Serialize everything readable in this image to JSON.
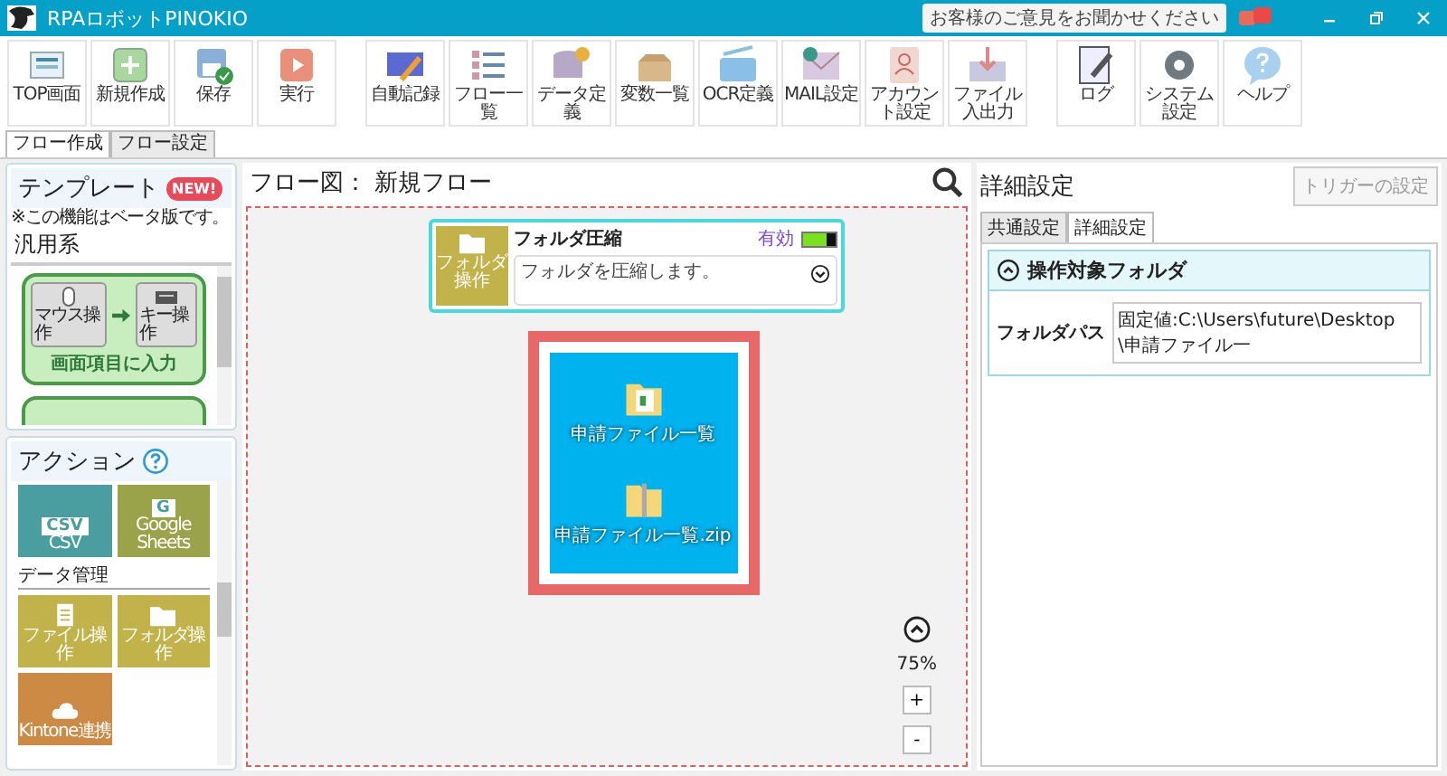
{
  "window": {
    "title": "RPAロボットPINOKIO",
    "feedback": "お客様のご意見をお聞かせください"
  },
  "toolbar": {
    "groups": [
      [
        {
          "label": "TOP画面",
          "kind": "home"
        },
        {
          "label": "新規作成",
          "kind": "new"
        },
        {
          "label": "保存",
          "kind": "save"
        },
        {
          "label": "実行",
          "kind": "run"
        }
      ],
      [
        {
          "label": "自動記録",
          "kind": "record"
        },
        {
          "label": "フロー一覧",
          "kind": "list"
        },
        {
          "label": "データ定義",
          "kind": "database"
        },
        {
          "label": "変数一覧",
          "kind": "box"
        },
        {
          "label": "OCR定義",
          "kind": "ocr"
        },
        {
          "label": "MAIL設定",
          "kind": "mail"
        },
        {
          "label": "アカウント設定",
          "kind": "account"
        },
        {
          "label": "ファイル入出力",
          "kind": "fileio"
        }
      ],
      [
        {
          "label": "ログ",
          "kind": "log"
        },
        {
          "label": "システム設定",
          "kind": "settings"
        },
        {
          "label": "ヘルプ",
          "kind": "help"
        }
      ]
    ]
  },
  "tabs": [
    {
      "label": "フロー作成",
      "selected": true
    },
    {
      "label": "フロー設定",
      "selected": false
    }
  ],
  "templates": {
    "title": "テンプレート",
    "badge": "NEW!",
    "note": "※この機能はベータ版です。",
    "category": "汎用系",
    "items": [
      {
        "label": "画面項目に入力",
        "from": "マウス操作",
        "to": "キー操作"
      }
    ]
  },
  "actions": {
    "title": "アクション",
    "sections": [
      {
        "items": [
          {
            "label": "CSV",
            "kind": "labeled",
            "icon_text": "CSV",
            "color": "#4a9ea0"
          },
          {
            "label": "Google Sheets",
            "kind": "labeled",
            "icon_text": "G",
            "color": "#9aa24a"
          }
        ]
      },
      {
        "heading": "データ管理",
        "items": [
          {
            "label": "ファイル操作",
            "kind": "document",
            "color": "#c2b24a"
          },
          {
            "label": "フォルダ操作",
            "kind": "folder",
            "color": "#c2b24a"
          },
          {
            "label": "Kintone連携",
            "kind": "cloud",
            "color": "#cc8a44"
          }
        ]
      }
    ]
  },
  "flow": {
    "title": "フロー図： 新規フロー",
    "node": {
      "icon_label": "フォルダ操作",
      "title": "フォルダ圧縮",
      "status": "有効",
      "enabled": true,
      "description": "フォルダを圧縮します。"
    },
    "preview": {
      "files": [
        {
          "name": "申請ファイル一覧",
          "kind": "folder"
        },
        {
          "name": "申請ファイル一覧.zip",
          "kind": "zip"
        }
      ]
    },
    "zoom": "75%",
    "zoom_in": "+",
    "zoom_out": "-"
  },
  "details": {
    "title": "詳細設定",
    "trigger_button": "トリガーの設定",
    "tabs": [
      {
        "label": "共通設定",
        "selected": false
      },
      {
        "label": "詳細設定",
        "selected": true
      }
    ],
    "section": {
      "title": "操作対象フォルダ",
      "expanded": true,
      "fields": [
        {
          "label": "フォルダパス",
          "value": "固定値:C:\\Users\\future\\Desktop\\申請ファイル一"
        }
      ]
    }
  }
}
